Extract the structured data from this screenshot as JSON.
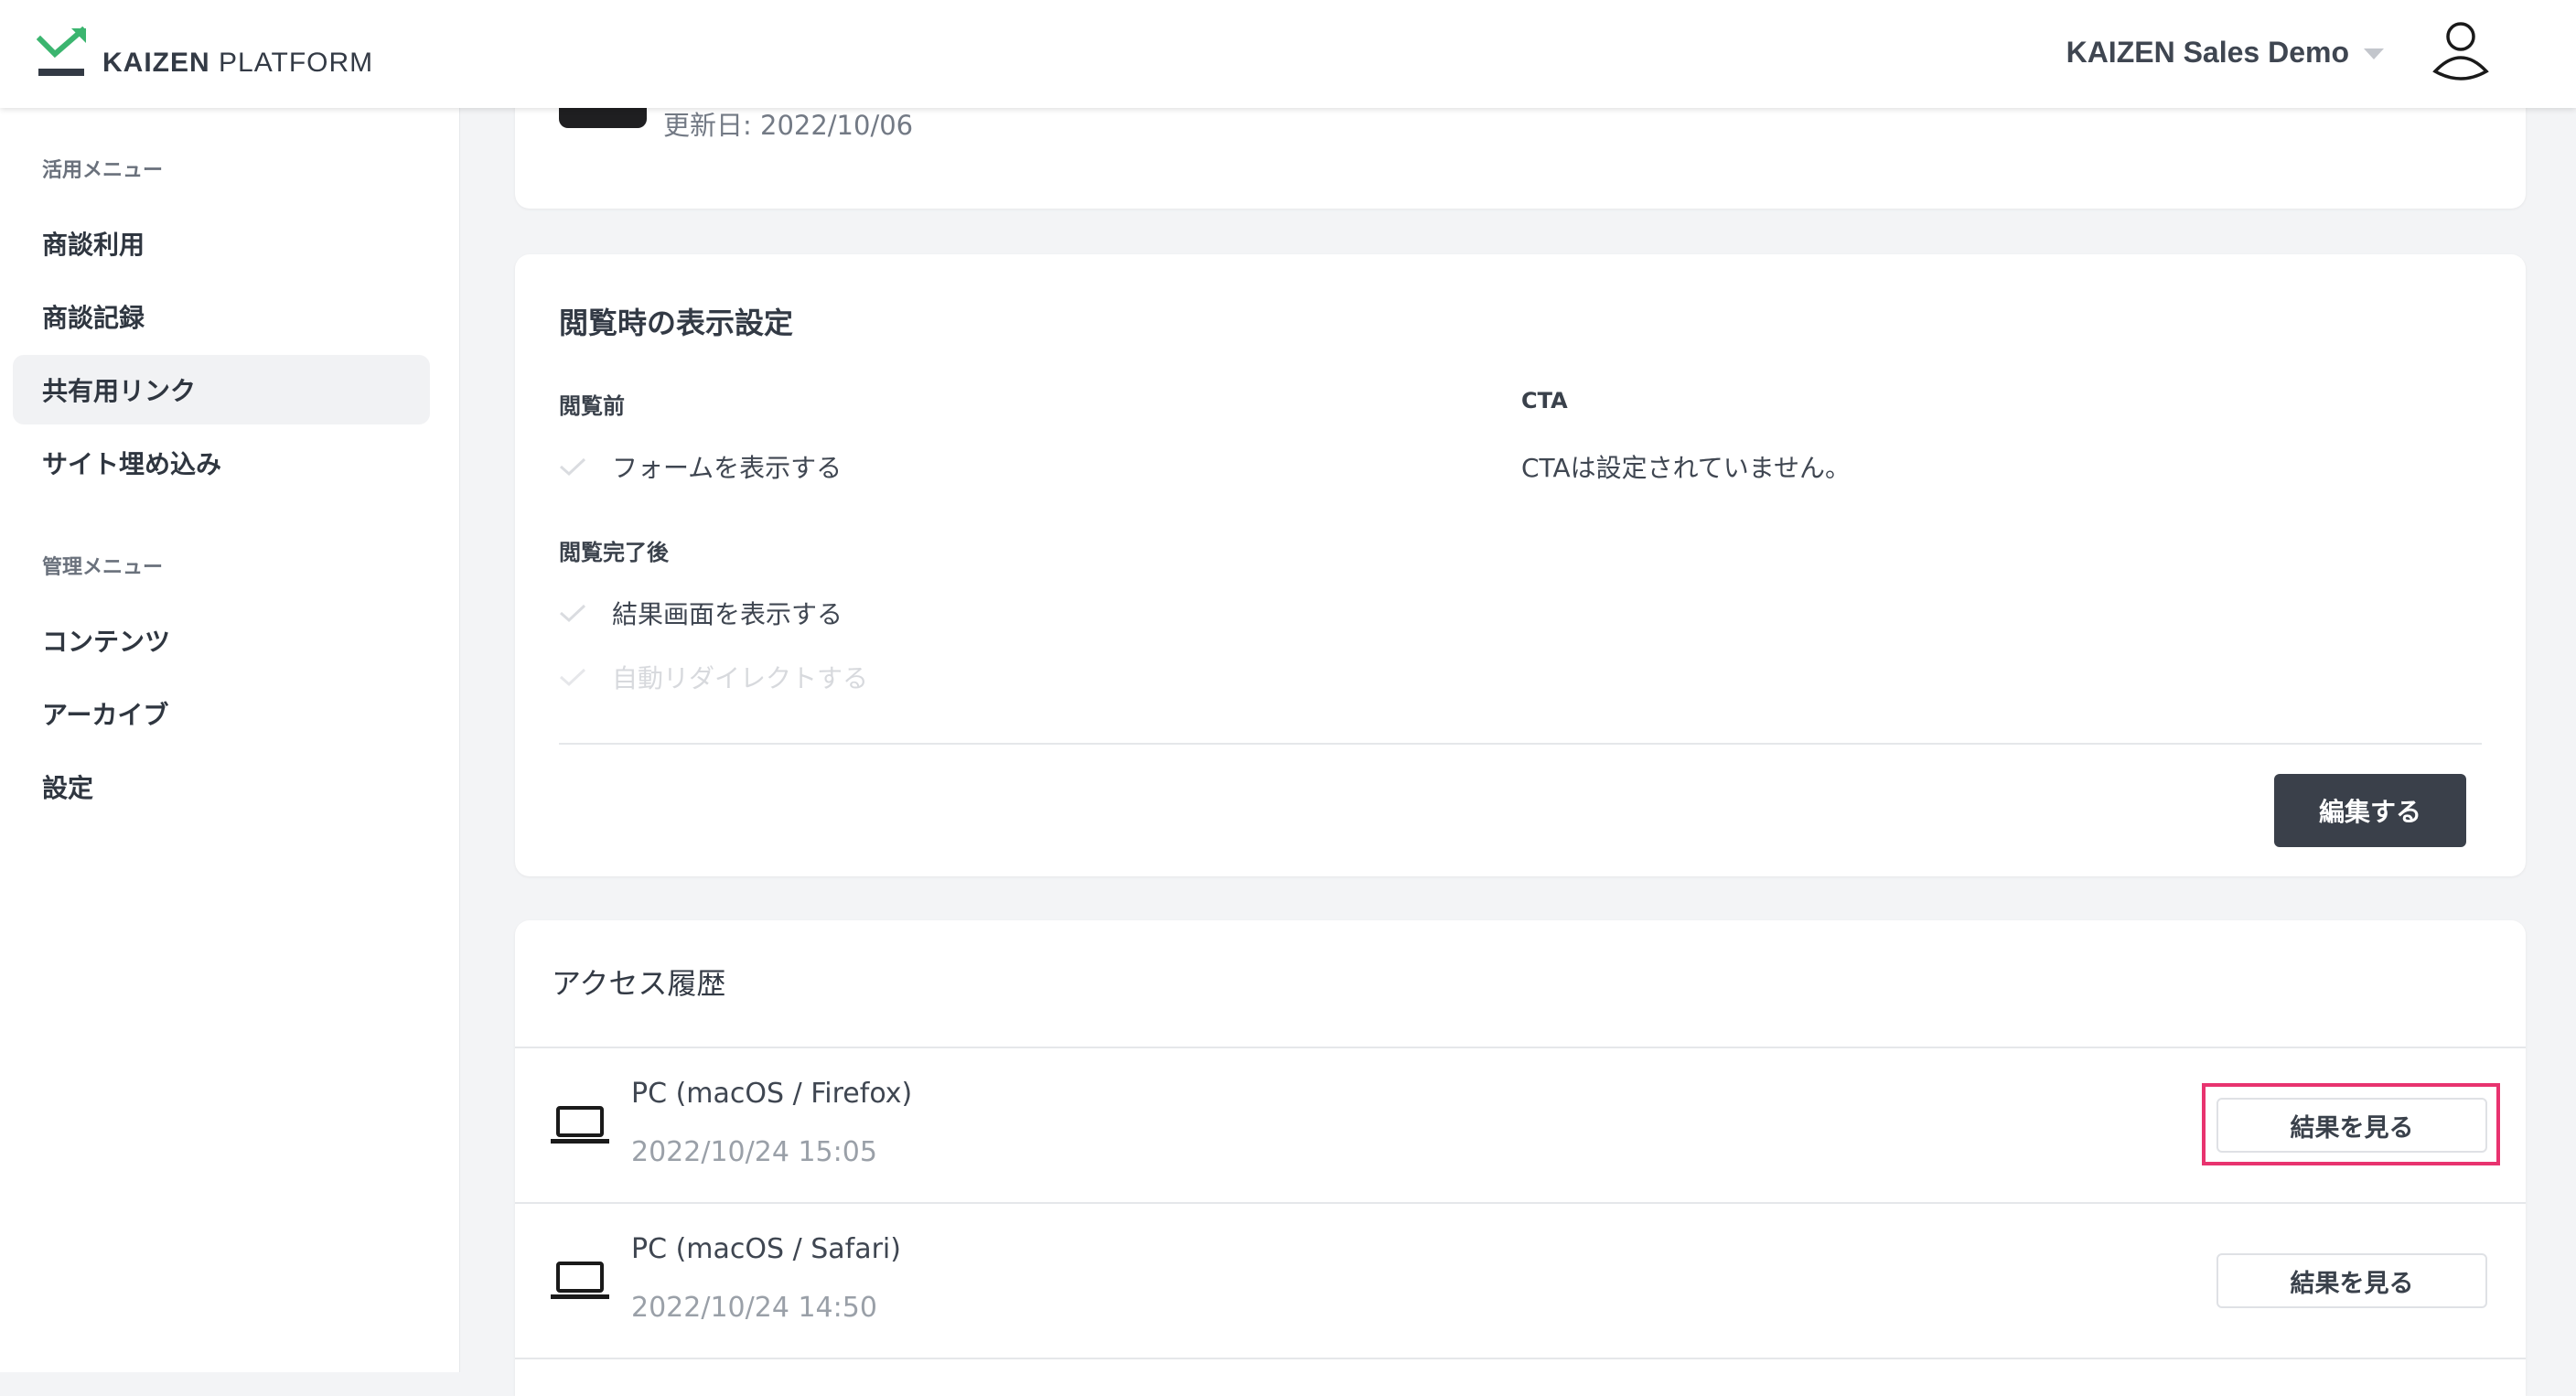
{
  "header": {
    "logo_bold": "KAIZEN",
    "logo_light": "PLATFORM",
    "account_name": "KAIZEN Sales Demo"
  },
  "sidebar": {
    "section1": "活用メニュー",
    "items1": [
      "商談利用",
      "商談記録",
      "共有用リンク",
      "サイト埋め込み"
    ],
    "section2": "管理メニュー",
    "items2": [
      "コンテンツ",
      "アーカイブ",
      "設定"
    ],
    "active_item": "共有用リンク"
  },
  "content_card": {
    "updated": "更新日: 2022/10/06"
  },
  "display_settings": {
    "title": "閲覧時の表示設定",
    "before_label": "閲覧前",
    "before_items": [
      "フォームを表示する"
    ],
    "after_label": "閲覧完了後",
    "after_items": [
      "結果画面を表示する",
      "自動リダイレクトする"
    ],
    "cta_label": "CTA",
    "cta_text": "CTAは設定されていません。",
    "edit_button": "編集する"
  },
  "access_history": {
    "title": "アクセス履歴",
    "rows": [
      {
        "device": "PC (macOS / Firefox)",
        "datetime": "2022/10/24 15:05",
        "button": "結果を見る"
      },
      {
        "device": "PC (macOS / Safari)",
        "datetime": "2022/10/24 14:50",
        "button": "結果を見る"
      }
    ]
  },
  "colors": {
    "accent_green": "#3bb56f",
    "highlight_pink": "#e8336f",
    "dark_button": "#3a404a"
  }
}
